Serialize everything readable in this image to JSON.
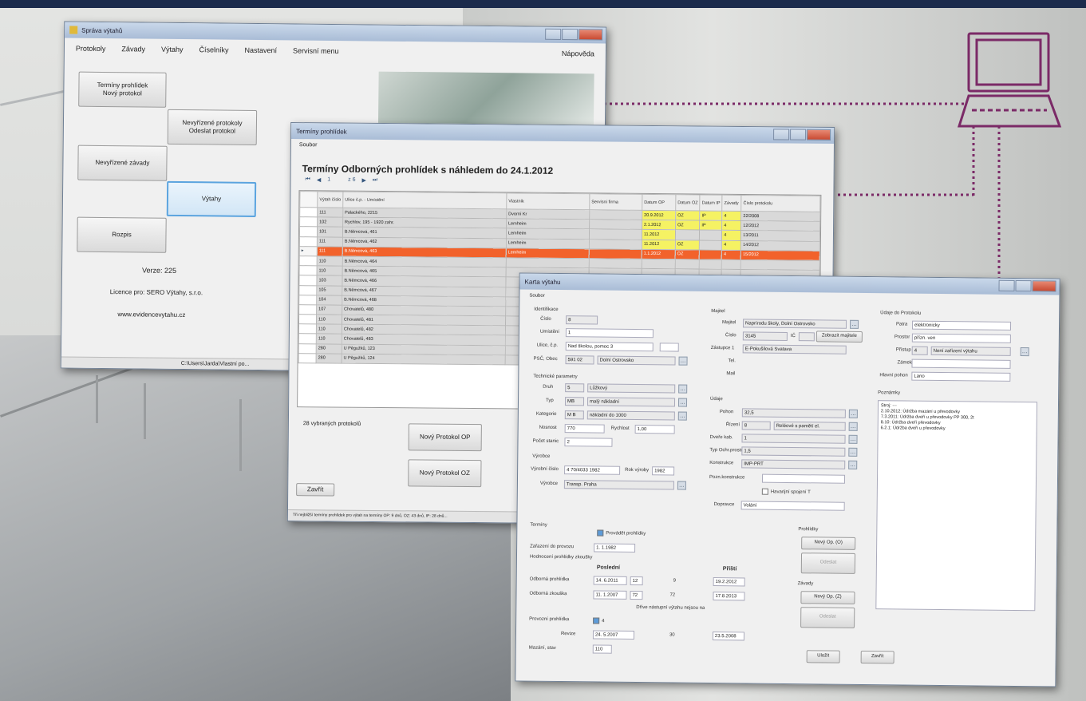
{
  "background": {
    "accent": "#7b2a67"
  },
  "main_window": {
    "title": "Správa výtahů",
    "menu": [
      "Protokoly",
      "Závady",
      "Výtahy",
      "Číselníky",
      "Nastavení",
      "Servisní menu"
    ],
    "help": "Nápověda",
    "buttons": {
      "terms": "Termíny prohlídek\nNový protokol",
      "unsigned": "Nevyřízené protokoly\nOdeslat protokol",
      "faults": "Nevyřízené závady",
      "lifts": "Výtahy",
      "schedule": "Rozpis"
    },
    "version": "Verze: 225",
    "license": "Licence pro: SERO Výtahy, s.r.o.",
    "website": "www.evidencevytahu.cz",
    "status": "C:\\Users\\Jarda\\Vlastní po..."
  },
  "list_window": {
    "title": "Termíny prohlídek",
    "menu": "Soubor",
    "heading": "Termíny Odborných prohlídek s náhledem do 24.1.2012",
    "nav": {
      "first": "⏮",
      "prev": "◀",
      "page": "1",
      "of": "z 6",
      "next": "▶",
      "last": "⏭"
    },
    "columns": [
      "Výtah číslo",
      "Ulice č.p. - Umístění",
      "Vlastník",
      "Servisní firma",
      "Datum OP",
      "Datum OZ",
      "Datum IP",
      "Závady",
      "Číslo protokolu"
    ],
    "rows": [
      [
        "111",
        "Palackého, 2215",
        "Dvorní Kr",
        "",
        "20.9.2012",
        "OZ",
        "IP",
        "4",
        "22/2008",
        "y"
      ],
      [
        "102",
        "Rychlov, 195 - 1920 zahr.",
        "Lemheim",
        "",
        "2.1.2012",
        "OZ",
        "IP",
        "4",
        "12/2012",
        "y"
      ],
      [
        "101",
        "B.Němcová, 461",
        "Lemheim",
        "",
        "11.2012",
        "",
        "",
        "4",
        "13/2011",
        "y"
      ],
      [
        "111",
        "B.Němcová, 462",
        "Lemheim",
        "",
        "11.2012",
        "OZ",
        "",
        "4",
        "14/2012",
        "y"
      ],
      [
        "111",
        "B.Němcová, 463",
        "Lemheim",
        "",
        "1.1.2012",
        "OZ",
        "",
        "4",
        "15/2012",
        "sel"
      ],
      [
        "110",
        "B.Němcová, 464",
        "",
        "",
        "",
        "",
        "",
        "",
        "",
        ""
      ],
      [
        "110",
        "B.Němcová, 465",
        "",
        "",
        "",
        "",
        "",
        "",
        "",
        ""
      ],
      [
        "103",
        "B.Němcová, 466",
        "",
        "",
        "",
        "",
        "",
        "",
        "",
        ""
      ],
      [
        "105",
        "B.Němcová, 467",
        "",
        "",
        "",
        "",
        "",
        "",
        "",
        ""
      ],
      [
        "104",
        "B.Němcová, 468",
        "",
        "",
        "",
        "",
        "",
        "",
        "",
        ""
      ],
      [
        "107",
        "Chovatelů, 480",
        "",
        "",
        "",
        "",
        "",
        "",
        "",
        ""
      ],
      [
        "110",
        "Chovatelů, 481",
        "",
        "",
        "",
        "",
        "",
        "",
        "",
        ""
      ],
      [
        "110",
        "Chovatelů, 482",
        "",
        "",
        "",
        "",
        "",
        "",
        "",
        ""
      ],
      [
        "110",
        "Chovatelů, 483",
        "",
        "",
        "",
        "",
        "",
        "",
        "",
        ""
      ],
      [
        "280",
        "U Pěgužků, 123",
        "",
        "",
        "",
        "",
        "",
        "",
        "",
        ""
      ],
      [
        "280",
        "U Pěgužků, 124",
        "",
        "",
        "",
        "",
        "",
        "",
        "",
        ""
      ]
    ],
    "count": "28 vybraných protokolů",
    "btn_op": "Nový Protokol OP",
    "btn_oz": "Nový Protokol OZ",
    "btn_close": "Zavřít",
    "status": "Tři nejbližší termíny prohlídek pro výtah na termíny OP: 9 dnů, OZ: 43 dnů, IP: 28 dnů..."
  },
  "detail_window": {
    "title": "Karta výtahu",
    "menu": "Soubor",
    "left": {
      "sec_ident": "Identifikace",
      "lbl_cislo": "Číslo",
      "cislo": "8",
      "lbl_umisteni": "Umístění",
      "umisteni": "1",
      "lbl_ulice": "Ulice, č.p.",
      "ulice": "Nad školou, pomoc 3",
      "lbl_psc": "PSČ, Obec",
      "psc": "591 02",
      "obec": "Dolní Ostrovsko",
      "sec_tech": "Technické parametry",
      "lbl_druh": "Druh",
      "druh": "5",
      "druh_txt": "Lůžkový",
      "lbl_typ": "Typ",
      "typ": "MB",
      "typ_txt": "malý nákladní",
      "lbl_kategorie": "Kategorie",
      "kategorie": "M B",
      "kategorie_txt": "nákladní do 1000",
      "lbl_nosnost": "Nosnost",
      "nosnost": "770",
      "lbl_rychlost": "Rychlost",
      "rychlost": "1,00",
      "lbl_stanic": "Počet stanic",
      "stanic": "2",
      "sec_vyr": "Výrobce",
      "lbl_vyrcislo": "Výrobní číslo",
      "vyrcislo": "4 70/4033 1982",
      "lbl_rok": "Rok výroby",
      "rok": "1982",
      "lbl_vyrobce": "Výrobce",
      "vyrobce": "Transp. Praha"
    },
    "middle": {
      "sec_majitel": "Majitel",
      "lbl_majitel": "Majitel",
      "majitel": "Naprírodu školy, Dolní Ostrovsko",
      "lbl_cislo": "Číslo",
      "cislo": "3145",
      "lbl_sml": "IČ",
      "btn_smlouva": "Zobrazit majitele",
      "lbl_zastupce": "Zástupce 1",
      "zastupce": "E-Pokušilová Svatava",
      "lbl_tel": "Tel.",
      "lbl_mail": "Mail",
      "sec_udaje": "Údaje",
      "lbl_pohon": "Pohon",
      "pohon": "32,5",
      "lbl_rizeni": "Řízení",
      "rizeni": "8",
      "rizeni_txt": "Reléové s pamětí el.",
      "lbl_dvere": "Dveře kab.",
      "dvere": "1",
      "lbl_tachy": "Typ Ochr.prostoru",
      "tachy": "1,5",
      "lbl_kons": "Konstrukce",
      "kons": "IMP-PRT",
      "lbl_kons2": "Pozn.konstrukce",
      "lbl_hlavni": "Havarijní spojení T",
      "lbl_dopravce": "Dopravce",
      "dopravce": "Volání"
    },
    "right": {
      "sec_objekt": "Údaje do Protokolu",
      "lbl_patra": "Patra",
      "patra": "elektronicky",
      "lbl_prostor": "Prostor",
      "prostor": "přízn. ven",
      "lbl_prist": "Přístup",
      "prist": "4",
      "prist_txt": "Není zařízení výtahu",
      "lbl_zam": "Zámek",
      "lbl_poh": "Hlavní pohon",
      "poh": "Lano",
      "sec_pozn": "Poznámky",
      "notes": [
        "Stroj: ---",
        "2.10.2012: Údržba mazání u převodovky",
        "7.3.2011: Údržba dveří u převodovky PP 300, 2t",
        "8.10: Údržba dveří převodovky",
        "6.2.1: Údržba dveří u převodovky"
      ]
    },
    "bottom": {
      "sec_terms": "Termíny",
      "chk_prohlidky": "Provádět prohlídky",
      "lbl_zarazeni": "Zařazení do provozu",
      "zarazeni": "1. 1.1982",
      "lbl_interval": "Hodnocení prohlídky zkoušky",
      "col_posl": "Poslední",
      "col_pristi": "Příští",
      "lbl_op": "Odborná prohlídka",
      "op_date": "14. 6.2011",
      "op_mes": "12",
      "op_zbyva": "9",
      "op_pristi": "19.2.2012",
      "lbl_oz": "Odborná zkouška",
      "oz_date": "11. 1.2007",
      "oz_mes": "72",
      "oz_zbyva": "72",
      "oz_pristi": "17.8.2013",
      "lbl_info": "Dříve nástupní výtahu nejsou na",
      "lbl_ip": "Provozní prohlídka",
      "ip_val": "4",
      "lbl_revize": "Revize",
      "revize": "24. 5.2007",
      "rev_zbyva": "30",
      "rev_pristi": "23.5.2008",
      "lbl_stav": "Mazání, stav",
      "stav": "110",
      "sec_provoz": "Prohlídky",
      "btn_novy1": "Nový Op. (O)",
      "btn_odeslat1": "Odeslat",
      "sec_zavady": "Závady",
      "btn_novy2": "Nový Op. (Z)",
      "btn_odeslat2": "Odeslat",
      "btn_ulozit": "Uložit",
      "btn_zavrit": "Zavřít"
    }
  }
}
